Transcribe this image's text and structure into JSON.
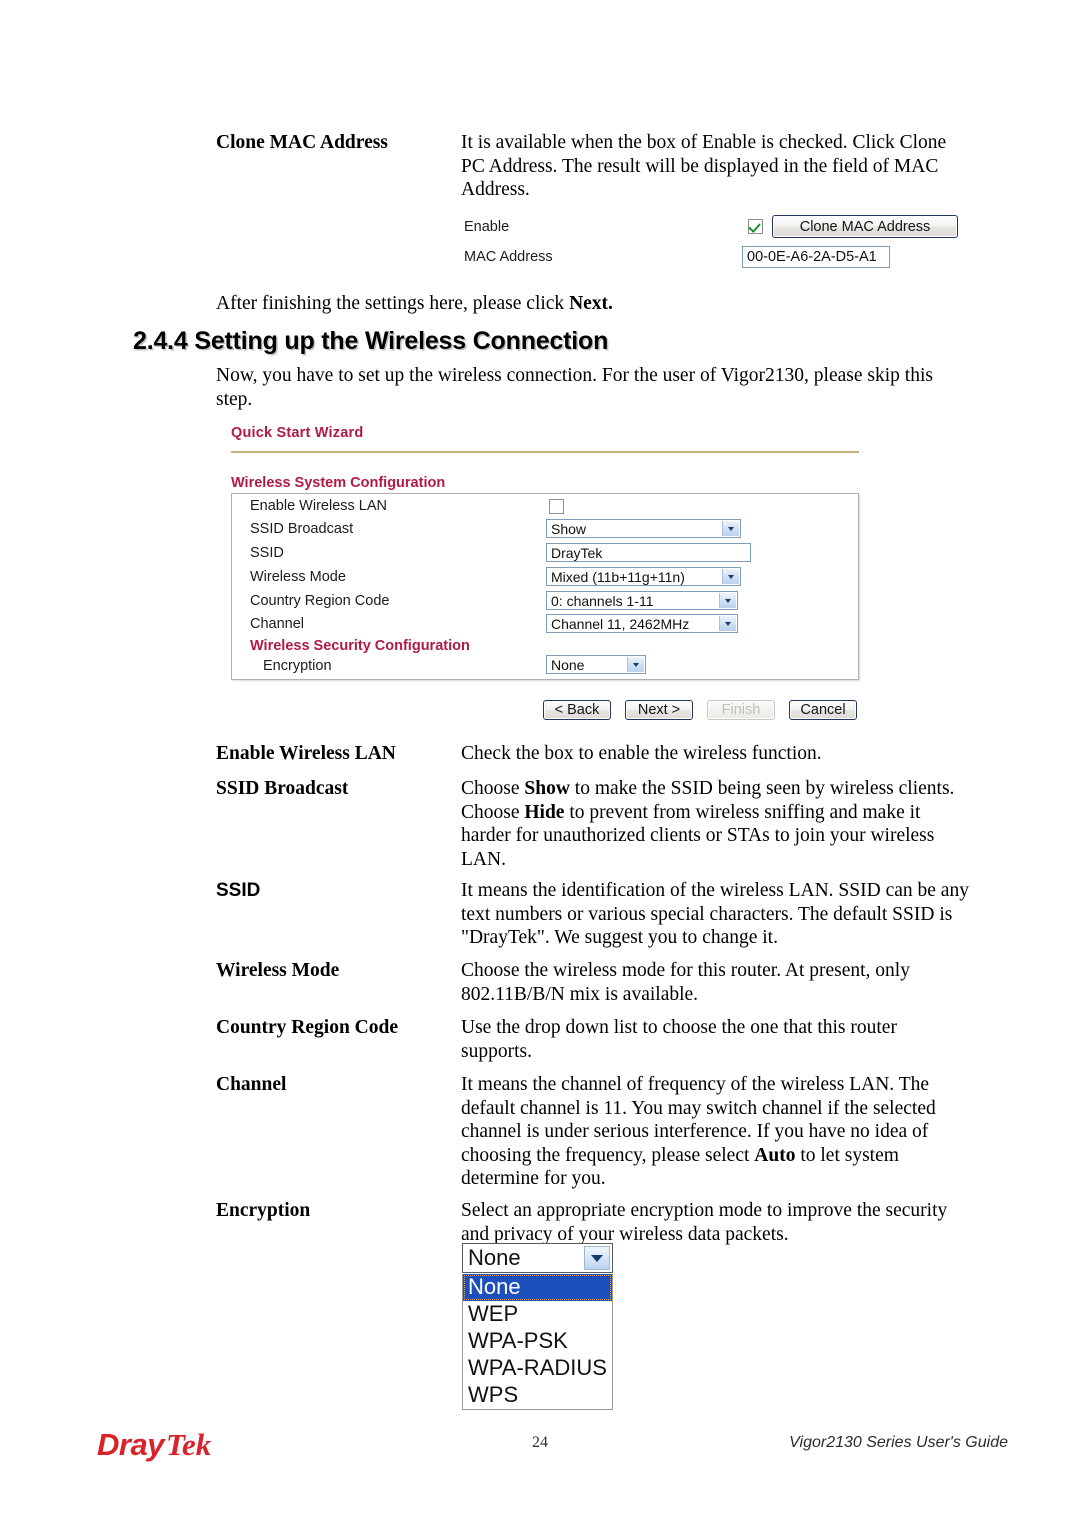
{
  "clone_mac": {
    "term": "Clone MAC Address",
    "description": "It is available when the box of Enable is checked. Click Clone PC Address. The result will be displayed in the field of MAC Address.",
    "enable_label": "Enable",
    "enable_checked": true,
    "button_label": "Clone MAC Address",
    "mac_label": "MAC Address",
    "mac_value": "00-0E-A6-2A-D5-A1"
  },
  "after_note": {
    "text_before": "After finishing the settings here, please click ",
    "bold": "Next."
  },
  "section": {
    "heading": "2.4.4 Setting up the Wireless Connection",
    "intro": "Now, you have to set up the wireless connection. For the user of Vigor2130, please skip this step."
  },
  "wizard": {
    "title": "Quick Start Wizard",
    "panel_caption": "Wireless System Configuration",
    "security_caption": "Wireless Security Configuration",
    "rows": [
      {
        "label": "Enable Wireless LAN",
        "control": "checkbox",
        "checked": false
      },
      {
        "label": "SSID Broadcast",
        "control": "select",
        "value": "Show"
      },
      {
        "label": "SSID",
        "control": "text",
        "value": "DrayTek"
      },
      {
        "label": "Wireless Mode",
        "control": "select",
        "value": "Mixed (11b+11g+11n)"
      },
      {
        "label": "Country Region Code",
        "control": "select",
        "value": "0: channels 1-11"
      },
      {
        "label": "Channel",
        "control": "select",
        "value": "Channel 11, 2462MHz"
      },
      {
        "label": "Encryption",
        "control": "select",
        "value": "None"
      }
    ],
    "buttons": [
      {
        "label": "< Back",
        "disabled": false
      },
      {
        "label": "Next >",
        "disabled": false
      },
      {
        "label": "Finish",
        "disabled": true
      },
      {
        "label": "Cancel",
        "disabled": false
      }
    ]
  },
  "definitions": [
    {
      "term": "Enable Wireless LAN",
      "desc": "Check the box to enable the wireless function."
    },
    {
      "term": "SSID Broadcast",
      "desc_html": "Choose <b>Show</b> to make the SSID being seen by wireless clients. Choose <b>Hide</b> to prevent from wireless sniffing and make it harder for unauthorized clients or STAs to join your wireless LAN."
    },
    {
      "term": "SSID",
      "desc": "It means the identification of the wireless LAN. SSID can be any text numbers or various special characters. The default SSID is \"DrayTek\". We suggest you to change it."
    },
    {
      "term": "Wireless Mode",
      "desc": "Choose the wireless mode for this router. At present, only 802.11B/B/N mix is available."
    },
    {
      "term": "Country Region Code",
      "desc": "Use the drop down list to choose the one that this router supports."
    },
    {
      "term": "Channel",
      "desc_html": "It means the channel of frequency of the wireless LAN. The default channel is 11. You may switch channel if the selected channel is under serious interference. If you have no idea of choosing the frequency, please select <b>Auto</b> to let system determine for you."
    },
    {
      "term": "Encryption",
      "desc": "Select an appropriate encryption mode to improve the security and privacy of your wireless data packets."
    }
  ],
  "encryption_dropdown": {
    "selected": "None",
    "options": [
      "None",
      "WEP",
      "WPA-PSK",
      "WPA-RADIUS",
      "WPS"
    ]
  },
  "footer": {
    "logo_first": "Dray",
    "logo_second": "Tek",
    "page_number": "24",
    "guide": "Vigor2130 Series User's Guide"
  },
  "colors": {
    "brand_red": "#d8232a",
    "heading_red": "#b01b43",
    "rule_tan": "#c3b179",
    "select_highlight": "#1d4fbd"
  }
}
